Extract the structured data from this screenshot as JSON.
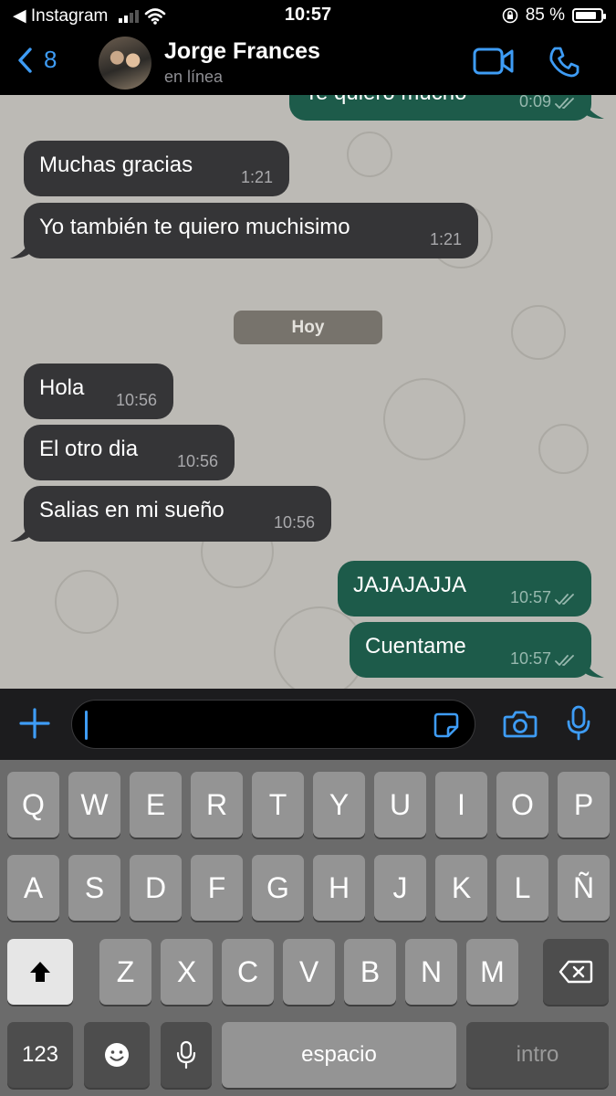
{
  "status_bar": {
    "back_app": "◀ Instagram",
    "time": "10:57",
    "battery_percent": "85 %",
    "battery_level": 0.85,
    "signal_bars": 2
  },
  "header": {
    "back_count": "8",
    "contact_name": "Jorge Frances",
    "contact_status": "en línea",
    "icons": [
      "chevron-left-icon",
      "video-call-icon",
      "phone-icon"
    ]
  },
  "chat": {
    "partial_message": {
      "text": "Te quiero mucho",
      "time": "0:09"
    },
    "messages_before": [
      {
        "text": "Muchas gracias",
        "time": "1:21",
        "direction": "incoming"
      },
      {
        "text": "Yo también te quiero muchisimo",
        "time": "1:21",
        "direction": "incoming"
      }
    ],
    "day_separator": "Hoy",
    "messages_today_in": [
      {
        "text": "Hola",
        "time": "10:56"
      },
      {
        "text": "El otro dia",
        "time": "10:56"
      },
      {
        "text": "Salias en mi sueño",
        "time": "10:56"
      }
    ],
    "messages_today_out": [
      {
        "text": "JAJAJAJJA",
        "time": "10:57",
        "status": "read"
      },
      {
        "text": "Cuentame",
        "time": "10:57",
        "status": "read"
      }
    ],
    "colors": {
      "incoming": "#353537",
      "outgoing": "#1d5b4a",
      "wallpaper": "#bcbab5"
    }
  },
  "input_bar": {
    "value": "",
    "icons": [
      "plus-icon",
      "sticker-icon",
      "camera-icon",
      "microphone-icon"
    ],
    "accent": "#3e9cf5"
  },
  "keyboard": {
    "row1": [
      "Q",
      "W",
      "E",
      "R",
      "T",
      "Y",
      "U",
      "I",
      "O",
      "P"
    ],
    "row2": [
      "A",
      "S",
      "D",
      "F",
      "G",
      "H",
      "J",
      "K",
      "L",
      "Ñ"
    ],
    "row3": [
      "Z",
      "X",
      "C",
      "V",
      "B",
      "N",
      "M"
    ],
    "numbers_key": "123",
    "space_key": "espacio",
    "return_key": "intro"
  }
}
